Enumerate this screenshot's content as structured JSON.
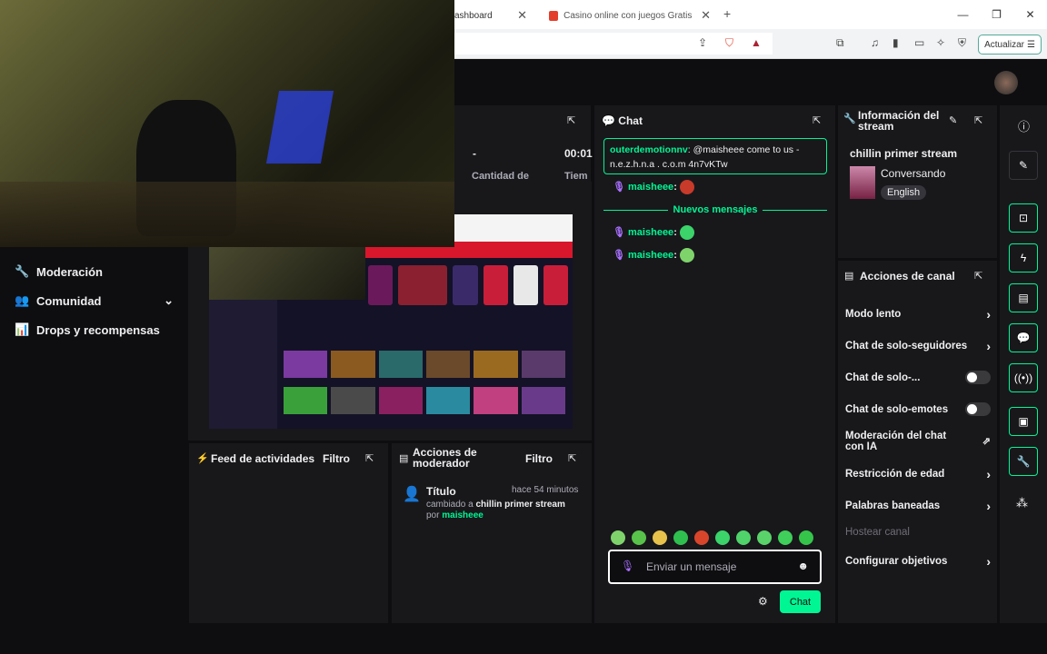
{
  "browser": {
    "tabs": [
      {
        "label": "ashboard"
      },
      {
        "label": "Casino online con juegos Gratis y slo"
      }
    ],
    "update_label": "Actualizar"
  },
  "stats": {
    "dash": "-",
    "time": "00:01",
    "cantidad_label": "Cantidad de",
    "tiempo_label": "Tiem"
  },
  "left_nav": [
    {
      "label": "Moderación",
      "icon": "wrench-icon"
    },
    {
      "label": "Comunidad",
      "icon": "people-icon"
    },
    {
      "label": "Drops y recompensas",
      "icon": "chart-icon"
    }
  ],
  "chat": {
    "title": "Chat",
    "pinned": {
      "user": "outerdemotionnv",
      "text": "@maisheee come to us - n.e.z.h.n.a . c.o.m 4n7vKTw"
    },
    "messages": [
      {
        "user": "maisheee"
      }
    ],
    "new_messages_label": "Nuevos mensajes",
    "new_messages": [
      {
        "user": "maisheee"
      },
      {
        "user": "maisheee"
      }
    ],
    "input_placeholder": "Enviar un mensaje",
    "send_label": "Chat",
    "emote_colors": [
      "#7fd36b",
      "#58c24a",
      "#e8c24a",
      "#2fbf4f",
      "#d9452b",
      "#3bd36a",
      "#4fd36a",
      "#5ad36a",
      "#3fcf5a",
      "#35c54a"
    ]
  },
  "stream_info": {
    "title": "Información del stream",
    "stream_title": "chillin primer stream",
    "category": "Conversando",
    "language": "English"
  },
  "channel_actions": {
    "title": "Acciones de canal",
    "items": [
      {
        "label": "Modo lento",
        "type": "chevron"
      },
      {
        "label": "Chat de solo-seguidores",
        "type": "chevron"
      },
      {
        "label": "Chat de solo-...",
        "type": "toggle"
      },
      {
        "label": "Chat de solo-emotes",
        "type": "toggle"
      },
      {
        "label": "Moderación del chat con IA",
        "type": "external"
      },
      {
        "label": "Restricción de edad",
        "type": "chevron"
      },
      {
        "label": "Palabras baneadas",
        "type": "chevron"
      },
      {
        "label": "Hostear canal",
        "type": "disabled"
      },
      {
        "label": "Configurar objetivos",
        "type": "chevron"
      }
    ]
  },
  "activity_feed": {
    "title": "Feed de actividades",
    "filter_label": "Filtro"
  },
  "mod_actions": {
    "title": "Acciones de moderador",
    "filter_label": "Filtro",
    "entry": {
      "heading": "Título",
      "time": "hace 54 minutos",
      "line1_prefix": "cambiado a",
      "line1_value": "chillin primer stream",
      "line2_prefix": "por",
      "line2_user": "maisheee"
    }
  },
  "colors": {
    "accent": "#00f593",
    "panel": "#18181b",
    "background": "#0e0e10"
  }
}
